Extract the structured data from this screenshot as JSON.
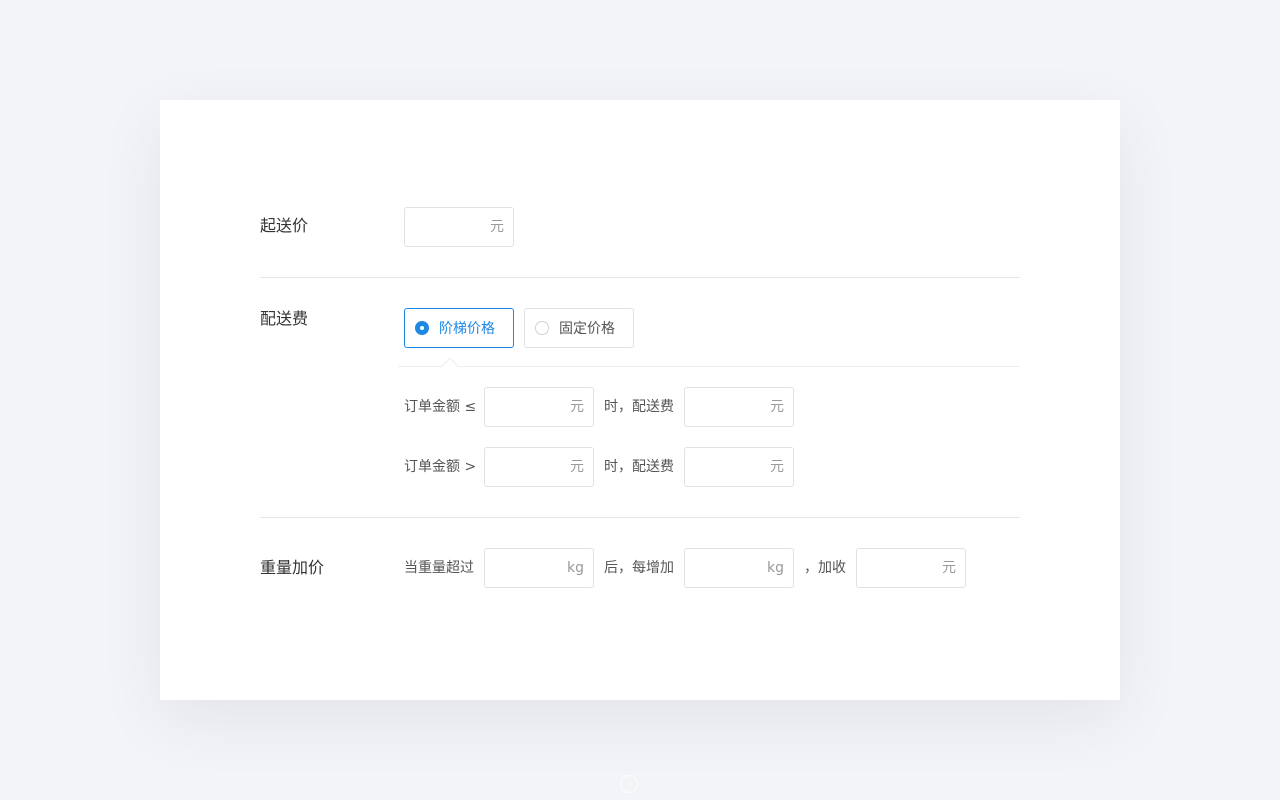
{
  "min_order": {
    "label": "起送价",
    "unit": "元",
    "value": ""
  },
  "delivery_fee": {
    "label": "配送费",
    "options": [
      {
        "label": "阶梯价格",
        "selected": true
      },
      {
        "label": "固定价格",
        "selected": false
      }
    ],
    "tiers": [
      {
        "prefix": "订单金额 ≤",
        "amount_unit": "元",
        "mid": "时，配送费",
        "fee_unit": "元"
      },
      {
        "prefix": "订单金额 >",
        "amount_unit": "元",
        "mid": "时，配送费",
        "fee_unit": "元"
      }
    ]
  },
  "weight_surcharge": {
    "label": "重量加价",
    "prefix": "当重量超过",
    "threshold_unit": "kg",
    "mid": "后，每增加",
    "step_unit": "kg",
    "mid2": "，加收",
    "fee_unit": "元"
  },
  "colors": {
    "accent": "#1e88e5",
    "background": "#f3f4f8",
    "card": "#ffffff",
    "border": "#dfe1e6"
  }
}
